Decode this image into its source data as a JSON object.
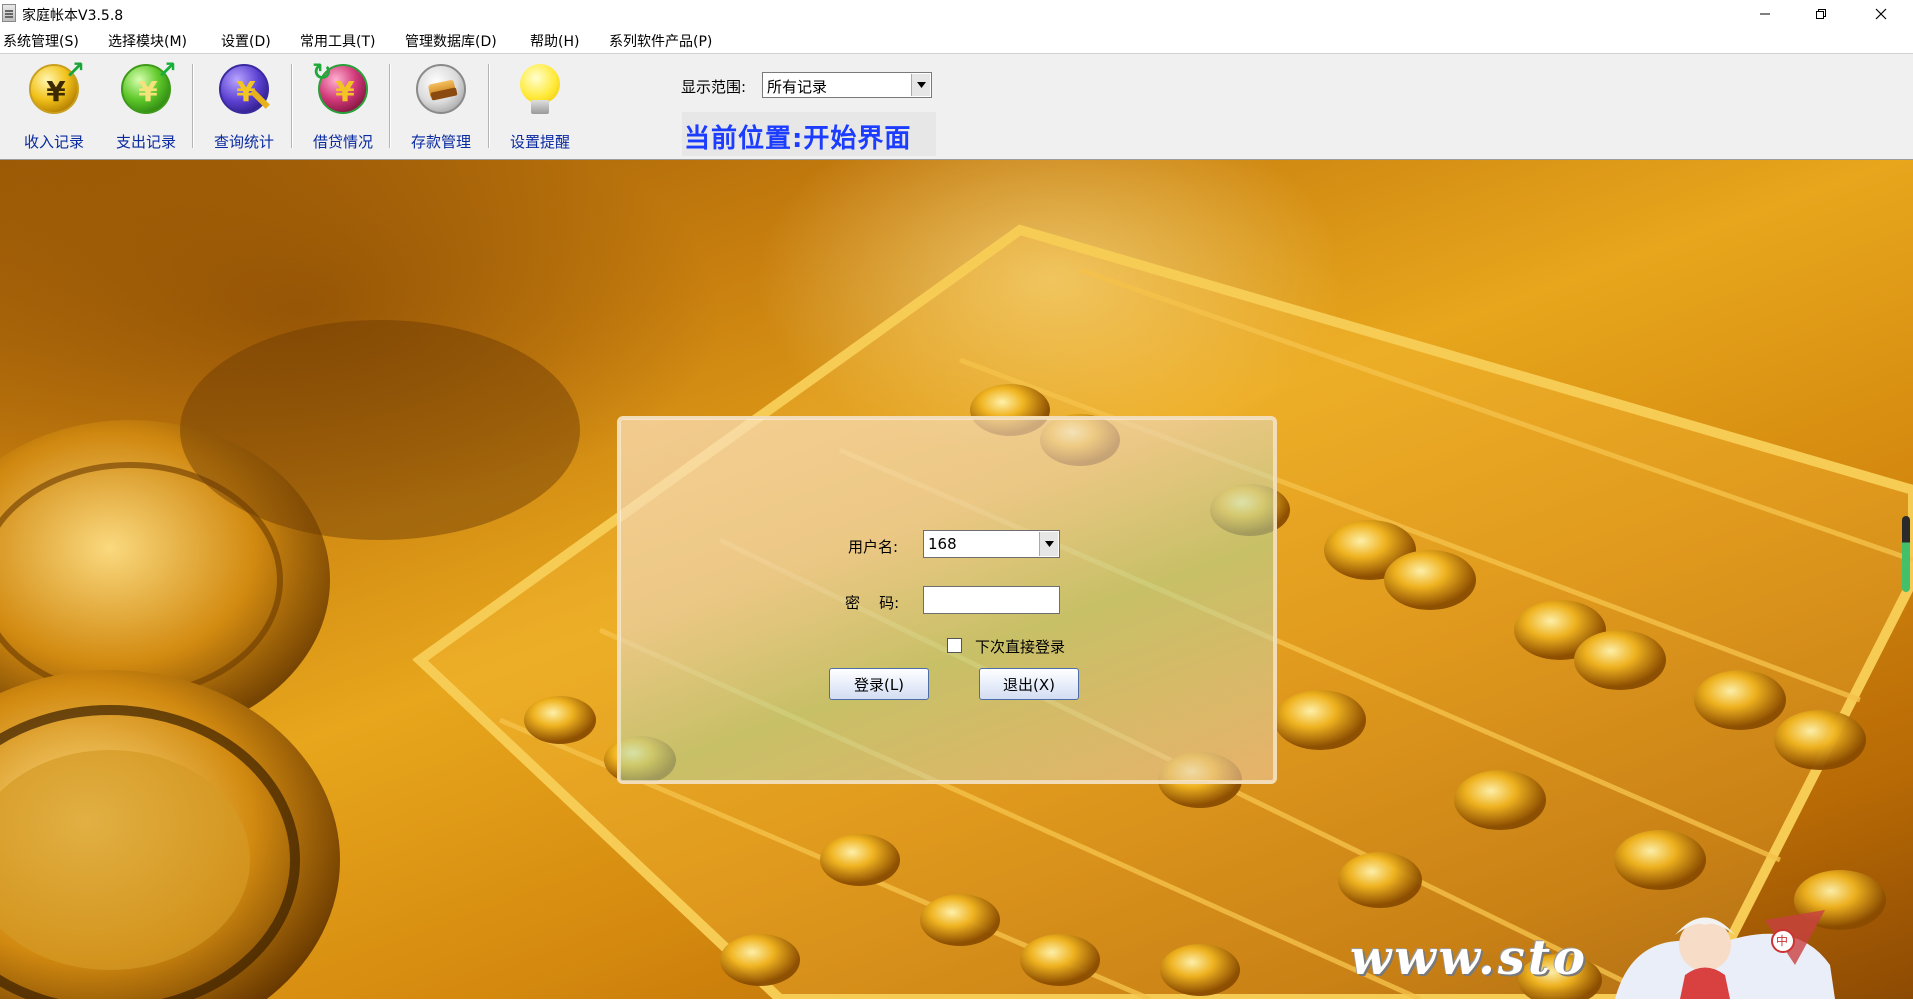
{
  "window": {
    "title": "家庭帐本V3.5.8"
  },
  "menu": {
    "items": [
      "系统管理(S)",
      "选择模块(M)",
      "设置(D)",
      "常用工具(T)",
      "管理数据库(D)",
      "帮助(H)",
      "系列软件产品(P)"
    ]
  },
  "toolbar": {
    "buttons": [
      {
        "label": "收入记录",
        "icon": "yuan-coin-income-icon"
      },
      {
        "label": "支出记录",
        "icon": "yuan-coin-expense-icon"
      },
      {
        "label": "查询统计",
        "icon": "magnifier-coin-icon"
      },
      {
        "label": "借贷情况",
        "icon": "yuan-coin-exchange-icon"
      },
      {
        "label": "存款管理",
        "icon": "deposit-box-icon"
      },
      {
        "label": "设置提醒",
        "icon": "light-bulb-icon"
      }
    ],
    "range_label": "显示范围:",
    "range_value": "所有记录",
    "location": "当前位置:开始界面"
  },
  "login": {
    "username_label": "用户名:",
    "username_value": "168",
    "password_label": "密    码:",
    "password_value": "",
    "auto_login_label": "下次直接登录",
    "auto_login_checked": false,
    "login_button": "登录(L)",
    "exit_button": "退出(X)"
  },
  "watermark": "www.sto",
  "mascot_badge": "中",
  "colors": {
    "accent": "#1c3cff",
    "toolbar_label": "#0a2aa0",
    "background_gold": "#d9971a"
  }
}
